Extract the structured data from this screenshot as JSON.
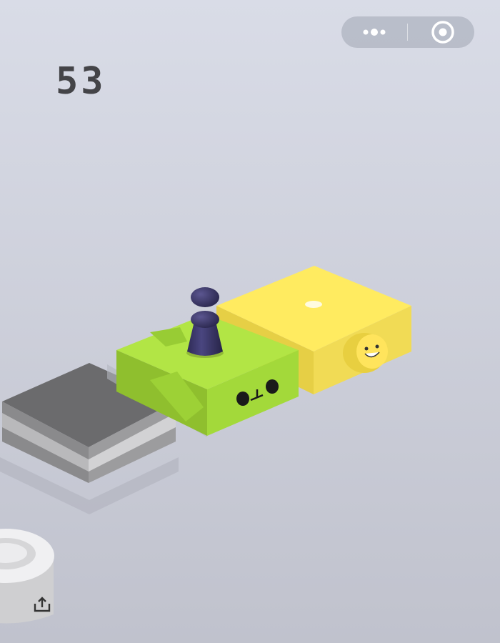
{
  "score": "53",
  "colors": {
    "background_top": "#d8dbe6",
    "background_bottom": "#c2c4cf",
    "gray_block_top": "#6a6a6b",
    "green_block_top": "#ade53f",
    "yellow_block_top": "#ffe95e",
    "player": "#3a3668"
  },
  "icons": {
    "more": "more-dots-icon",
    "close": "target-circle-icon",
    "share": "share-upload-icon"
  }
}
